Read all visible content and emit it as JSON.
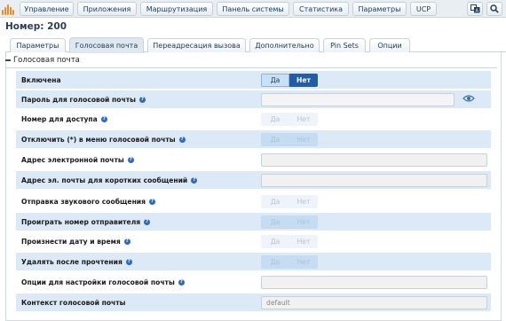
{
  "topnav": {
    "items": [
      "Управление",
      "Приложения",
      "Маршрутизация",
      "Панель системы",
      "Статистика",
      "Параметры",
      "UCP"
    ]
  },
  "page": {
    "title": "Номер: 200"
  },
  "tabs": [
    "Параметры",
    "Голосовая почта",
    "Переадресация вызова",
    "Дополнительно",
    "Pin Sets",
    "Опции"
  ],
  "active_tab": "Голосовая почта",
  "section": {
    "title": "Голосовая почта"
  },
  "toggle": {
    "yes": "Да",
    "no": "Нет"
  },
  "fields": [
    {
      "label": "Включена",
      "type": "toggle",
      "selected": "Нет",
      "enabled": true,
      "help": false
    },
    {
      "label": "Пароль для голосовой почты",
      "type": "password",
      "value": "",
      "help": true
    },
    {
      "label": "Номер для доступа",
      "type": "toggle",
      "enabled": false,
      "help": true
    },
    {
      "label": "Отключить (*) в меню голосовой почты",
      "type": "toggle",
      "enabled": false,
      "help": true
    },
    {
      "label": "Адрес электронной почты",
      "type": "text",
      "value": "",
      "help": true
    },
    {
      "label": "Адрес эл. почты для коротких сообщений",
      "type": "text",
      "value": "",
      "help": true
    },
    {
      "label": "Отправка звукового сообщения",
      "type": "toggle",
      "enabled": false,
      "help": true
    },
    {
      "label": "Проиграть номер отправителя",
      "type": "toggle",
      "enabled": false,
      "help": true
    },
    {
      "label": "Произнести дату и время",
      "type": "toggle",
      "enabled": false,
      "help": true
    },
    {
      "label": "Удалять после прочтения",
      "type": "toggle",
      "enabled": false,
      "help": true
    },
    {
      "label": "Опции для настройки голосовой почты",
      "type": "text",
      "value": "",
      "help": true
    },
    {
      "label": "Контекст голосовой почты",
      "type": "text",
      "value": "default",
      "help": false
    }
  ],
  "colors": {
    "accent": "#1f5fa8",
    "row_shade": "#dce9f6",
    "logo": "#f08a24"
  },
  "icons": {
    "help": "question-circle-icon",
    "show_password": "eye-icon",
    "language": "language-icon",
    "search": "search-icon"
  },
  "help_glyph": "?"
}
